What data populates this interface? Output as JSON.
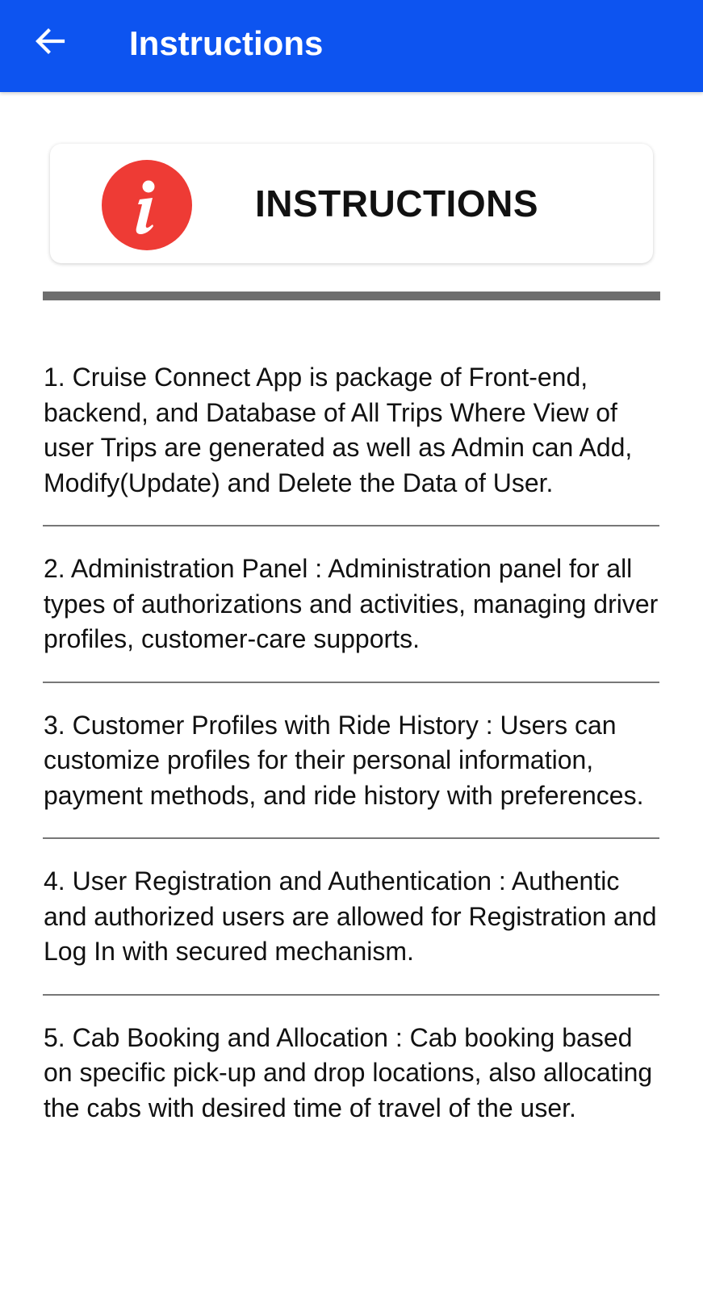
{
  "app_bar": {
    "back_icon": "arrow-left-icon",
    "title": "Instructions",
    "color": "#0d54f0"
  },
  "header_card": {
    "icon": "info-icon",
    "icon_color": "#ee3b35",
    "title": "INSTRUCTIONS"
  },
  "instructions": {
    "item_1": "1. Cruise Connect App is package of Front-end, backend, and Database of All Trips Where View of user Trips are generated as well as Admin can Add, Modify(Update) and Delete the Data of User.",
    "item_2": "2. Administration Panel : Administration panel for all types of authorizations and activities, managing driver profiles, customer-care supports.",
    "item_3": "3. Customer Profiles with Ride History : Users can customize profiles for their personal information, payment methods, and ride history with preferences.",
    "item_4": "4. User Registration and Authentication : Authentic and authorized users are allowed for Registration and Log In with secured mechanism.",
    "item_5": "5. Cab Booking and Allocation : Cab booking based on specific pick-up and drop locations, also allocating the cabs with desired time of travel of the user."
  }
}
